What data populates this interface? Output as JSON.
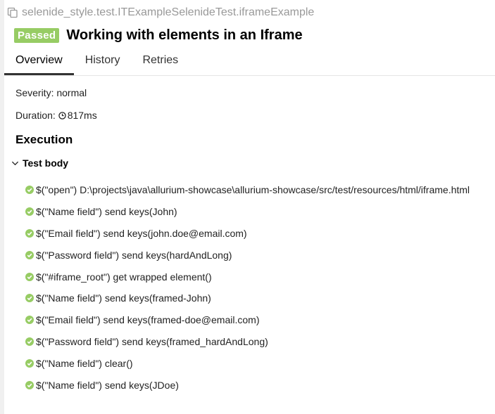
{
  "header": {
    "path": "selenide_style.test.ITExampleSelenideTest.iframeExample",
    "status": "Passed",
    "title": "Working with elements in an Iframe"
  },
  "tabs": [
    {
      "label": "Overview",
      "active": true
    },
    {
      "label": "History",
      "active": false
    },
    {
      "label": "Retries",
      "active": false
    }
  ],
  "meta": {
    "severity_label": "Severity:",
    "severity_value": "normal",
    "duration_label": "Duration:",
    "duration_value": "817ms"
  },
  "execution": {
    "title": "Execution",
    "test_body_label": "Test body",
    "steps": [
      "$(\"open\") D:\\projects\\java\\allurium-showcase\\allurium-showcase/src/test/resources/html/iframe.html",
      "$(\"Name field\") send keys(John)",
      "$(\"Email field\") send keys(john.doe@email.com)",
      "$(\"Password field\") send keys(hardAndLong)",
      "$(\"#iframe_root\") get wrapped element()",
      "$(\"Name field\") send keys(framed-John)",
      "$(\"Email field\") send keys(framed-doe@email.com)",
      "$(\"Password field\") send keys(framed_hardAndLong)",
      "$(\"Name field\") clear()",
      "$(\"Name field\") send keys(JDoe)"
    ]
  },
  "colors": {
    "passed": "#97cc64",
    "muted_text": "#999999"
  },
  "icons": {
    "path": "copy-icon",
    "duration": "clock-icon",
    "test_body": "chevron-down-icon",
    "step": "check-circle-icon"
  }
}
